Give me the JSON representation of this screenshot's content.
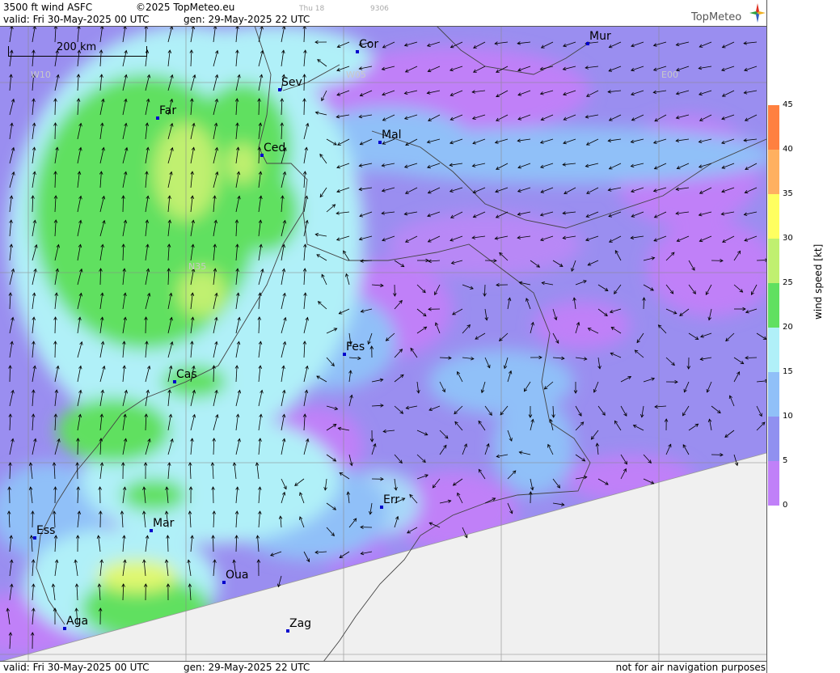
{
  "header": {
    "title": "3500 ft wind ASFC",
    "copyright": "©2025 TopMeteo.eu",
    "faint_day": "Thu 18",
    "faint_code": "9306",
    "valid": "valid:  Fri  30-May-2025  00 UTC",
    "generated": "gen: 29-May-2025 22 UTC"
  },
  "footer": {
    "valid": "valid:  Fri  30-May-2025  00 UTC",
    "generated": "gen: 29-May-2025 22 UTC",
    "note": "not for air navigation purposes"
  },
  "logo": {
    "text": "TopMeteo",
    "icon": "compass-star-icon"
  },
  "scale": {
    "label": "200 km"
  },
  "coords": {
    "w10": "W10",
    "w05": "W05",
    "e00": "E00",
    "n35": "N35"
  },
  "cities": [
    {
      "name": "Cor"
    },
    {
      "name": "Mur"
    },
    {
      "name": "Sev"
    },
    {
      "name": "Far"
    },
    {
      "name": "Ced"
    },
    {
      "name": "Mal"
    },
    {
      "name": "Fes"
    },
    {
      "name": "Cas"
    },
    {
      "name": "Err"
    },
    {
      "name": "Ess"
    },
    {
      "name": "Mar"
    },
    {
      "name": "Oua"
    },
    {
      "name": "Aga"
    },
    {
      "name": "Zag"
    }
  ],
  "legend": {
    "title": "wind speed [kt]",
    "ticks": [
      "45",
      "40",
      "35",
      "30",
      "25",
      "20",
      "15",
      "10",
      "5",
      "0"
    ],
    "colors": [
      "#c080f8",
      "#9090f0",
      "#90c0f8",
      "#b0f0f8",
      "#60e060",
      "#c0f070",
      "#ffff60",
      "#ffb060",
      "#ff8040",
      "#f06050"
    ]
  }
}
